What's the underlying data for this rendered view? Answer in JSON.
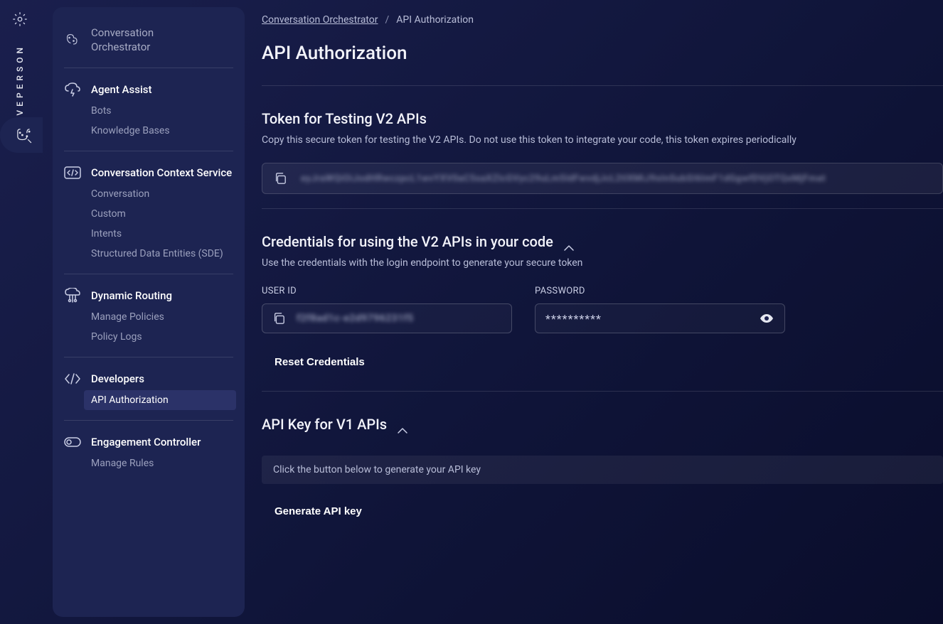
{
  "brand": "LIVEPERSON",
  "sidebar": {
    "header_title_line1": "Conversation",
    "header_title_line2": "Orchestrator",
    "groups": [
      {
        "label": "Agent Assist",
        "items": [
          "Bots",
          "Knowledge Bases"
        ]
      },
      {
        "label": "Conversation Context Service",
        "items": [
          "Conversation",
          "Custom",
          "Intents",
          "Structured Data Entities (SDE)"
        ]
      },
      {
        "label": "Dynamic Routing",
        "items": [
          "Manage Policies",
          "Policy Logs"
        ]
      },
      {
        "label": "Developers",
        "items": [
          "API Authorization"
        ],
        "active_index": 0
      },
      {
        "label": "Engagement Controller",
        "items": [
          "Manage Rules"
        ]
      }
    ]
  },
  "breadcrumb": {
    "root": "Conversation Orchestrator",
    "current": "API Authorization"
  },
  "page_title": "API Authorization",
  "token_section": {
    "title": "Token for Testing V2 APIs",
    "desc": "Copy this secure token for testing the V2 APIs. Do not use this token to integrate your code, this token expires periodically",
    "masked_value": "eyJraWQiOiJodHRwczpcL1wvYXV0aC5saXZlcGVyc29uLm5ldFwvdjJcL2tlXMiJ9sInSubSI6ImF1dGgwfDVjOTQxMjFmat"
  },
  "credentials_section": {
    "title": "Credentials for using the V2 APIs in your code",
    "desc": "Use the credentials with the login endpoint to generate your secure token",
    "user_id_label": "USER ID",
    "user_id_masked": "f2f8ad1c-e2d9796231f5",
    "password_label": "PASSWORD",
    "password_mask": "**********",
    "reset_button": "Reset Credentials"
  },
  "apikey_section": {
    "title": "API Key for V1 APIs",
    "placeholder": "Click the button below to generate your API key",
    "generate_button": "Generate API key"
  }
}
